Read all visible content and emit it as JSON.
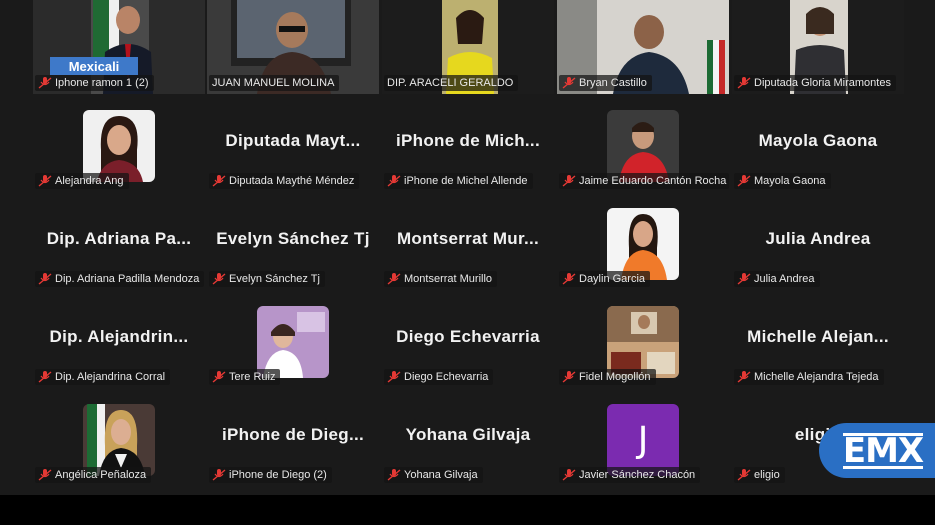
{
  "location_badge": "Mexicali",
  "brand": "EMX",
  "participants": [
    {
      "id": "p1",
      "name": "Iphone ramon 1 (2)",
      "kind": "video"
    },
    {
      "id": "p2",
      "name": "JUAN MANUEL MOLINA",
      "kind": "video",
      "active": true
    },
    {
      "id": "p3",
      "name": "DIP. ARACELI GERALDO",
      "kind": "video"
    },
    {
      "id": "p4",
      "name": "Bryan Castillo",
      "kind": "video"
    },
    {
      "id": "p5",
      "name": "Diputada Gloria Miramontes",
      "kind": "video"
    },
    {
      "id": "p6",
      "name": "Alejandra Ang",
      "kind": "photo"
    },
    {
      "id": "p7",
      "name": "Diputada Maythé Méndez",
      "display": "Diputada  Mayt...",
      "kind": "text"
    },
    {
      "id": "p8",
      "name": "iPhone de Michel Allende",
      "display": "iPhone  de  Mich...",
      "kind": "text"
    },
    {
      "id": "p9",
      "name": "Jaime Eduardo Cantón Rocha",
      "kind": "photo"
    },
    {
      "id": "p10",
      "name": "Mayola Gaona",
      "display": "Mayola  Gaona",
      "kind": "text"
    },
    {
      "id": "p11",
      "name": "Dip. Adriana Padilla Mendoza",
      "display": "Dip.  Adriana  Pa...",
      "kind": "text"
    },
    {
      "id": "p12",
      "name": "Evelyn Sánchez Tj",
      "display": "Evelyn  Sánchez  Tj",
      "kind": "text"
    },
    {
      "id": "p13",
      "name": "Montserrat Murillo",
      "display": "Montserrat  Mur...",
      "kind": "text"
    },
    {
      "id": "p14",
      "name": "Daylin Garcia",
      "kind": "photo"
    },
    {
      "id": "p15",
      "name": "Julia Andrea",
      "display": "Julia  Andrea",
      "kind": "text"
    },
    {
      "id": "p16",
      "name": "Dip. Alejandrina Corral",
      "display": "Dip.  Alejandrin...",
      "kind": "text"
    },
    {
      "id": "p17",
      "name": "Tere Ruiz",
      "kind": "photo"
    },
    {
      "id": "p18",
      "name": "Diego Echevarria",
      "display": "Diego  Echevarria",
      "kind": "text"
    },
    {
      "id": "p19",
      "name": "Fidel Mogollón",
      "kind": "photo"
    },
    {
      "id": "p20",
      "name": "Michelle Alejandra Tejeda",
      "display": "Michelle  Alejan...",
      "kind": "text"
    },
    {
      "id": "p21",
      "name": "Angélica Peñaloza",
      "kind": "photo"
    },
    {
      "id": "p22",
      "name": "iPhone de Diego (2)",
      "display": "iPhone  de  Dieg...",
      "kind": "text"
    },
    {
      "id": "p23",
      "name": "Yohana Gilvaja",
      "display": "Yohana  Gilvaja",
      "kind": "text"
    },
    {
      "id": "p24",
      "name": "Javier Sánchez Chacón",
      "initial": "J",
      "kind": "initial"
    },
    {
      "id": "p25",
      "name": "eligio",
      "display": "eligio",
      "kind": "text"
    }
  ]
}
